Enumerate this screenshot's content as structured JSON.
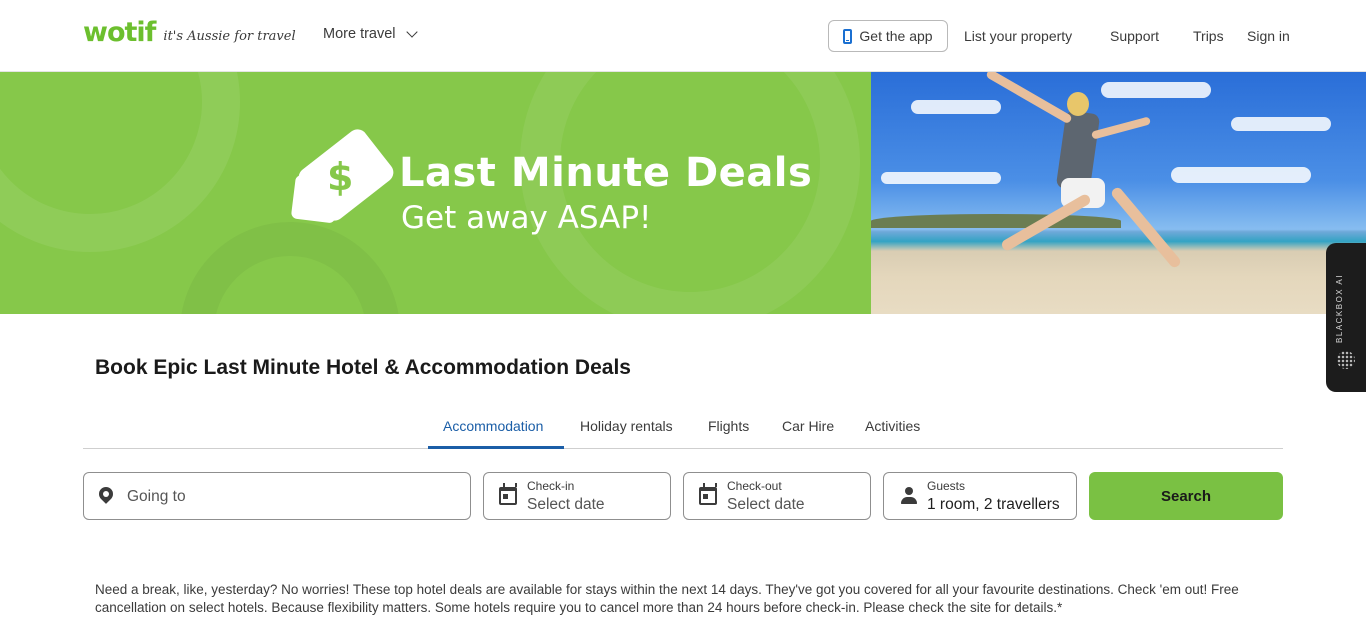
{
  "header": {
    "logo_text": "wotif",
    "logo_tagline": "it's Aussie for travel",
    "more_travel": "More travel",
    "get_app": "Get the app",
    "list_property": "List your property",
    "support": "Support",
    "trips": "Trips",
    "sign_in": "Sign in"
  },
  "banner": {
    "title": "Last Minute Deals",
    "subtitle": "Get away ASAP!",
    "tag_symbol": "$"
  },
  "side_widget": {
    "label": "BLACKBOX AI"
  },
  "main": {
    "title": "Book Epic Last Minute Hotel & Accommodation Deals",
    "tabs": [
      {
        "label": "Accommodation",
        "active": true
      },
      {
        "label": "Holiday rentals",
        "active": false
      },
      {
        "label": "Flights",
        "active": false
      },
      {
        "label": "Car Hire",
        "active": false
      },
      {
        "label": "Activities",
        "active": false
      }
    ],
    "search": {
      "destination_placeholder": "Going to",
      "checkin_label": "Check-in",
      "checkin_value": "Select date",
      "checkout_label": "Check-out",
      "checkout_value": "Select date",
      "guests_label": "Guests",
      "guests_value": "1 room, 2 travellers",
      "button": "Search"
    },
    "intro": "Need a break, like, yesterday? No worries! These top hotel deals are available for stays within the next 14 days. They've got you covered for all your favourite destinations. Check 'em out! Free cancellation on select hotels. Because flexibility matters. Some hotels require you to cancel more than 24 hours before check-in. Please check the site for details.*"
  },
  "colors": {
    "brand_green": "#7ac143",
    "banner_green": "#86c84a",
    "active_tab_blue": "#1b5ea7",
    "app_icon_blue": "#1a6fd1"
  }
}
